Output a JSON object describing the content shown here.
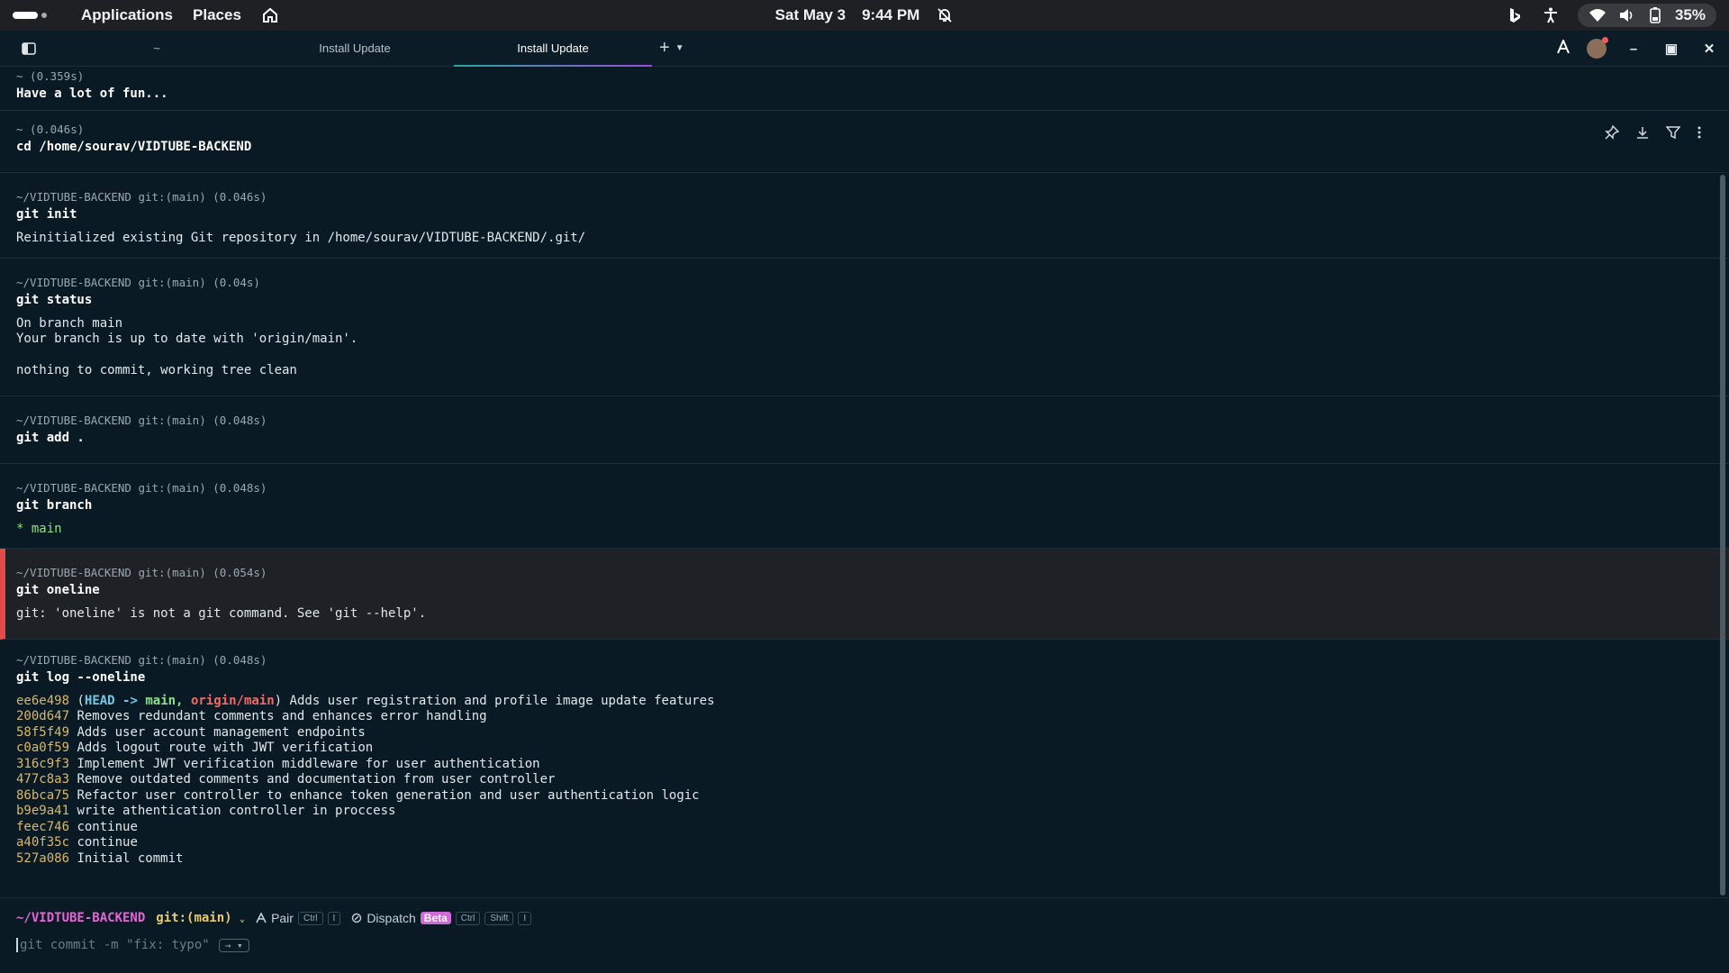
{
  "system_bar": {
    "menu_applications": "Applications",
    "menu_places": "Places",
    "date": "Sat May 3",
    "time": "9:44 PM",
    "battery": "35%"
  },
  "tabs": [
    {
      "label": "~"
    },
    {
      "label": "Install Update"
    },
    {
      "label": "Install Update"
    }
  ],
  "blocks": [
    {
      "meta": "~ (0.359s)",
      "command": "Have a lot of fun...",
      "output": []
    },
    {
      "meta": "~ (0.046s)",
      "command": "cd /home/sourav/VIDTUBE-BACKEND",
      "output": []
    },
    {
      "meta": "~/VIDTUBE-BACKEND git:(main) (0.046s)",
      "command": "git init",
      "output": [
        "Reinitialized existing Git repository in /home/sourav/VIDTUBE-BACKEND/.git/"
      ]
    },
    {
      "meta": "~/VIDTUBE-BACKEND git:(main) (0.04s)",
      "command": "git status",
      "output": [
        "On branch main",
        "Your branch is up to date with 'origin/main'.",
        "",
        "nothing to commit, working tree clean"
      ]
    },
    {
      "meta": "~/VIDTUBE-BACKEND git:(main) (0.048s)",
      "command": "git add .",
      "output": []
    },
    {
      "meta": "~/VIDTUBE-BACKEND git:(main) (0.048s)",
      "command": "git branch",
      "output": [
        "* main"
      ]
    },
    {
      "meta": "~/VIDTUBE-BACKEND git:(main) (0.054s)",
      "command": "git oneline",
      "output": [
        "git: 'oneline' is not a git command. See 'git --help'."
      ]
    },
    {
      "meta": "~/VIDTUBE-BACKEND git:(main) (0.048s)",
      "command": "git log --oneline",
      "output": []
    }
  ],
  "git_log": {
    "head": {
      "hash": "ee6e498",
      "open": "(",
      "head_label": "HEAD ->",
      "main_label": "main,",
      "origin_label": "origin/main",
      "close": ")",
      "message": "Adds user registration and profile image update features"
    },
    "commits": [
      {
        "hash": "200d647",
        "message": "Removes redundant comments and enhances error handling"
      },
      {
        "hash": "58f5f49",
        "message": "Adds user account management endpoints"
      },
      {
        "hash": "c0a0f59",
        "message": "Adds logout route with JWT verification"
      },
      {
        "hash": "316c9f3",
        "message": "Implement JWT verification middleware for user authentication"
      },
      {
        "hash": "477c8a3",
        "message": "Remove outdated comments and documentation from user controller"
      },
      {
        "hash": "86bca75",
        "message": "Refactor user controller to enhance token generation and user authentication logic"
      },
      {
        "hash": "b9e9a41",
        "message": "write athentication controller in proccess"
      },
      {
        "hash": "feec746",
        "message": "continue"
      },
      {
        "hash": "a40f35c",
        "message": "continue"
      },
      {
        "hash": "527a086",
        "message": "Initial commit"
      }
    ]
  },
  "prompt": {
    "path": "~/VIDTUBE-BACKEND",
    "git": "git:(main)",
    "pair_label": "Pair",
    "pair_kbd1": "Ctrl",
    "pair_kbd2": "I",
    "dispatch_label": "Dispatch",
    "beta_label": "Beta",
    "dispatch_kbd1": "Ctrl",
    "dispatch_kbd2": "Shift",
    "dispatch_kbd3": "I",
    "placeholder": "git commit -m \"fix: typo\"",
    "enter_hint": "→"
  },
  "icons": {
    "home": "home-icon",
    "bell": "bell-off-icon",
    "wifi": "wifi-icon",
    "volume": "volume-icon",
    "battery": "battery-icon"
  }
}
